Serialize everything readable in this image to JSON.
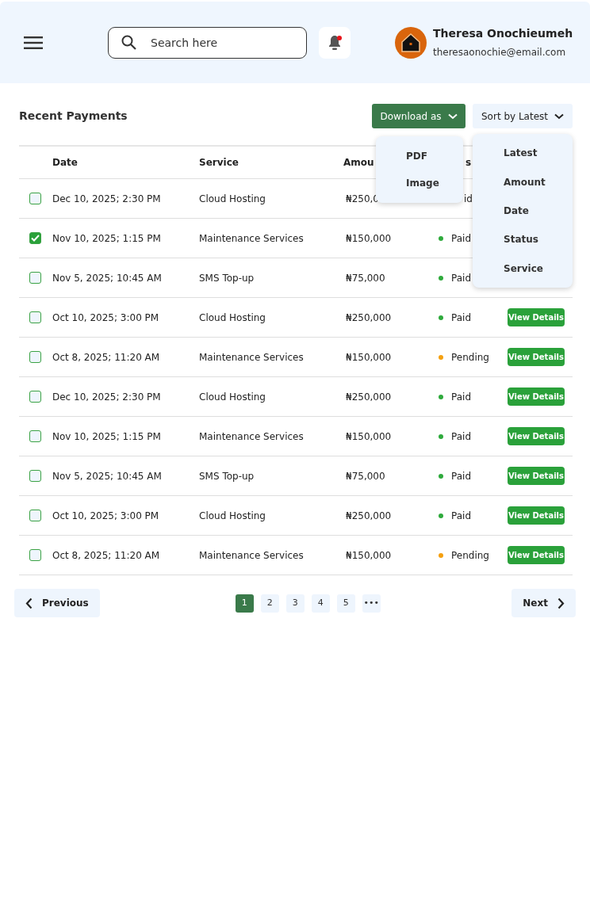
{
  "header": {
    "search": {
      "placeholder": "Search here"
    },
    "notification": {
      "unread": true
    },
    "user": {
      "name": "Theresa Onochieumeh",
      "email": "theresaonochie@email.com"
    }
  },
  "section_title": "Recent Payments",
  "download_button": {
    "label": "Download as",
    "expanded": true
  },
  "download_menu": [
    "PDF",
    "Image"
  ],
  "sort_button": {
    "label": "Sort by Latest",
    "expanded": true
  },
  "sort_menu": [
    "Latest",
    "Amount",
    "Date",
    "Status",
    "Service"
  ],
  "table": {
    "columns": [
      "Date",
      "Service",
      "Amou",
      "s"
    ],
    "rows": [
      {
        "checked": false,
        "date": "Dec 10, 2025; 2:30 PM",
        "service": "Cloud Hosting",
        "amount": "₦250,0",
        "status": "id"
      },
      {
        "checked": true,
        "date": "Nov 10, 2025; 1:15 PM",
        "service": "Maintenance Services",
        "amount": "₦150,000",
        "status": "Paid",
        "color": "#2eaa3c"
      },
      {
        "checked": false,
        "date": "Nov 5, 2025; 10:45 AM",
        "service": "SMS Top-up",
        "amount": "₦75,000",
        "status": "Paid",
        "color": "#2eaa3c"
      },
      {
        "checked": false,
        "date": "Oct 10, 2025; 3:00 PM",
        "service": "Cloud Hosting",
        "amount": "₦250,000",
        "status": "Paid",
        "color": "#2eaa3c",
        "action": "View Details"
      },
      {
        "checked": false,
        "date": "Oct 8, 2025; 11:20 AM",
        "service": "Maintenance Services",
        "amount": "₦150,000",
        "status": "Pending",
        "color": "#f5a00f",
        "action": "View Details"
      },
      {
        "checked": false,
        "date": "Dec 10, 2025; 2:30 PM",
        "service": "Cloud Hosting",
        "amount": "₦250,000",
        "status": "Paid",
        "color": "#2eaa3c",
        "action": "View Details"
      },
      {
        "checked": false,
        "date": "Nov 10, 2025; 1:15 PM",
        "service": "Maintenance Services",
        "amount": "₦150,000",
        "status": "Paid",
        "color": "#2eaa3c",
        "action": "View Details"
      },
      {
        "checked": false,
        "date": "Nov 5, 2025; 10:45 AM",
        "service": "SMS Top-up",
        "amount": "₦75,000",
        "status": "Paid",
        "color": "#2eaa3c",
        "action": "View Details"
      },
      {
        "checked": false,
        "date": "Oct 10, 2025; 3:00 PM",
        "service": "Cloud Hosting",
        "amount": "₦250,000",
        "status": "Paid",
        "color": "#2eaa3c",
        "action": "View Details"
      },
      {
        "checked": false,
        "date": "Oct 8, 2025; 11:20 AM",
        "service": "Maintenance Services",
        "amount": "₦150,000",
        "status": "Pending",
        "color": "#f5a00f",
        "action": "View Details"
      }
    ]
  },
  "pagination": {
    "previous": "Previous",
    "next": "Next",
    "pages": [
      {
        "label": "1",
        "selected": true
      },
      {
        "label": "2",
        "selected": false
      },
      {
        "label": "3",
        "selected": false
      },
      {
        "label": "4",
        "selected": false
      },
      {
        "label": "5",
        "selected": false
      },
      {
        "label": "•••",
        "selected": false
      }
    ]
  }
}
